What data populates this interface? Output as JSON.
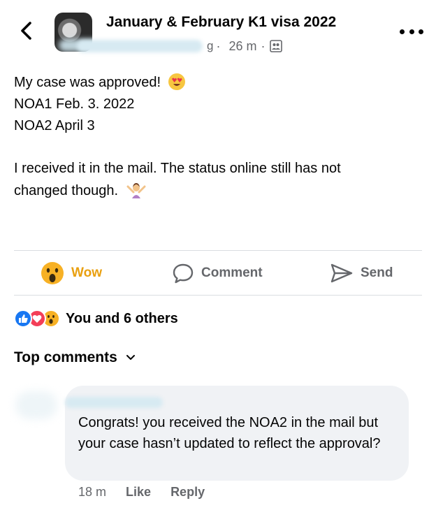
{
  "header": {
    "group_name": "January & February K1 visa 2022",
    "meta_fragment": "g",
    "time": "26 m",
    "separator": "·"
  },
  "post": {
    "lines": [
      "My case was approved!",
      "NOA1 Feb. 3. 2022",
      "NOA2 April 3"
    ],
    "para2_line1": "I received it in the mail. The status online still has not",
    "para2_line2": "changed though."
  },
  "actions": {
    "wow_label": "Wow",
    "comment_label": "Comment",
    "send_label": "Send"
  },
  "reactions": {
    "summary": "You and 6 others"
  },
  "comments": {
    "section_label": "Top comments",
    "items": [
      {
        "text": "Congrats! you received the NOA2 in the mail but your case hasn’t updated to reflect the approval?",
        "time": "18 m",
        "like_label": "Like",
        "reply_label": "Reply"
      }
    ]
  },
  "colors": {
    "wow_accent": "#e9a010",
    "like_blue": "#1877f2",
    "love_red": "#f33e58",
    "muted_gray": "#65676b",
    "bubble_bg": "#f0f2f5"
  }
}
